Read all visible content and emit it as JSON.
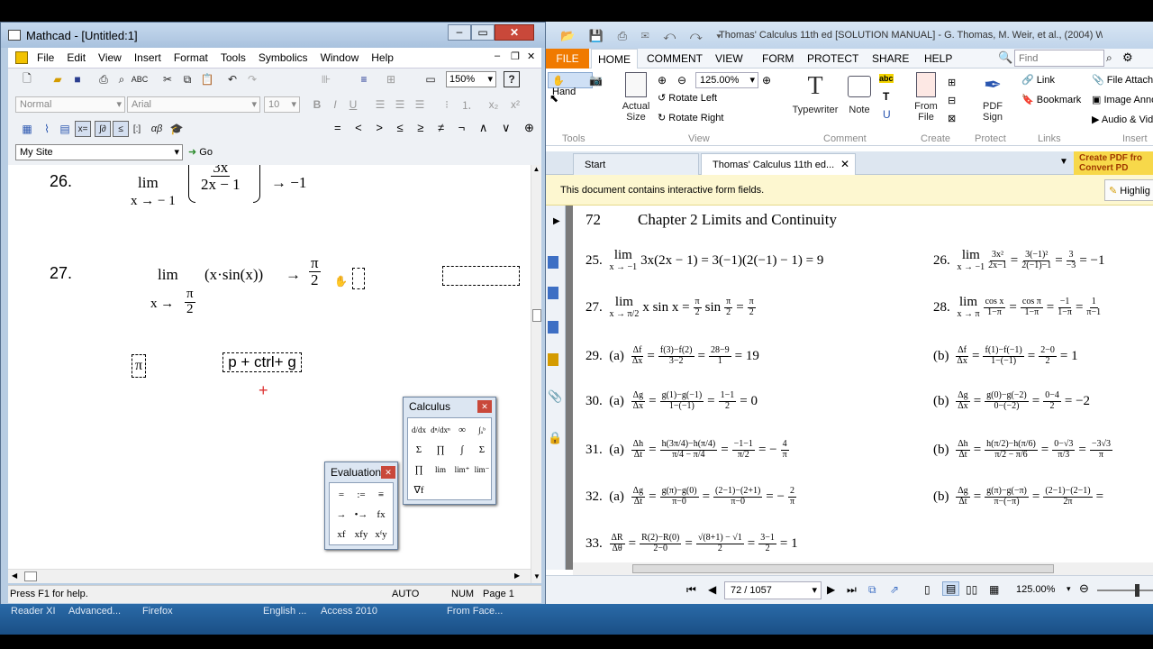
{
  "mathcad": {
    "title": "Mathcad - [Untitled:1]",
    "menu": [
      "File",
      "Edit",
      "View",
      "Insert",
      "Format",
      "Tools",
      "Symbolics",
      "Window",
      "Help"
    ],
    "style_value": "Normal",
    "font_value": "Arial",
    "size_value": "10",
    "zoom_value": "150%",
    "site_value": "My Site",
    "go_label": "Go",
    "operators": [
      "=",
      "<",
      ">",
      "≤",
      "≥",
      "≠",
      "¬",
      "∧",
      "∨",
      "⊕"
    ],
    "problems": [
      {
        "num": "26.",
        "lim": "lim",
        "sub": "x → − 1",
        "expr_num": "3x",
        "expr_den": "2x − 1",
        "result": "→ −1"
      },
      {
        "num": "27.",
        "lim": "lim",
        "sub": "x →",
        "sub_num": "π",
        "sub_den": "2",
        "expr": "(x·sin(x))",
        "arrow": "→",
        "res_num": "π",
        "res_den": "2"
      }
    ],
    "pi_symbol": "π",
    "typed_text": "p + ctrl+ g",
    "status": {
      "help": "Press F1 for help.",
      "mode": "AUTO",
      "num": "NUM",
      "page": "Page 1"
    },
    "calculus": {
      "title": "Calculus",
      "buttons": [
        "d/dx",
        "dⁿ/dxⁿ",
        "∞",
        "∫ₐᵇ",
        "Σ",
        "∏",
        "∫",
        "Σ",
        "∏",
        "lim",
        "lim⁺",
        "lim⁻",
        "∇f"
      ]
    },
    "evaluation": {
      "title": "Evaluation",
      "buttons": [
        "=",
        ":=",
        "≡",
        "→",
        "•→",
        "fx",
        "xf",
        "xfy",
        "xᶠy"
      ]
    }
  },
  "pdf": {
    "title": "Thomas' Calculus 11th ed [SOLUTION MANUAL] - G. Thomas, M. Weir, et al., (2004) WW...",
    "ribbon_tabs": [
      "FILE",
      "HOME",
      "COMMENT",
      "VIEW",
      "FORM",
      "PROTECT",
      "SHARE",
      "HELP"
    ],
    "find_placeholder": "Find",
    "hand": "Hand",
    "actual_size": "Actual Size",
    "zoom_value": "125.00%",
    "rotate_left": "Rotate Left",
    "rotate_right": "Rotate Right",
    "typewriter": "Typewriter",
    "note": "Note",
    "from_file": "From File",
    "pdf_sign": "PDF Sign",
    "link": "Link",
    "bookmark": "Bookmark",
    "file_attach": "File Attachm",
    "image_ann": "Image Anno",
    "audio": "Audio & Vid",
    "groups": [
      "Tools",
      "View",
      "Comment",
      "Create",
      "Protect",
      "Links",
      "Insert"
    ],
    "tabs": [
      "Start",
      "Thomas' Calculus 11th ed..."
    ],
    "create_pdf": "Create PDF fro Convert PD",
    "form_notice": "This document contains interactive form fields.",
    "highlight": "Highlig",
    "chapter": {
      "page": "72",
      "title": "Chapter 2 Limits and Continuity"
    },
    "page_nav": "72 / 1057",
    "zoom_bottom": "125.00%"
  },
  "taskbar": [
    "Reader XI",
    "Advanced...",
    "Firefox",
    "English ...",
    "Access 2010",
    "From Face..."
  ]
}
